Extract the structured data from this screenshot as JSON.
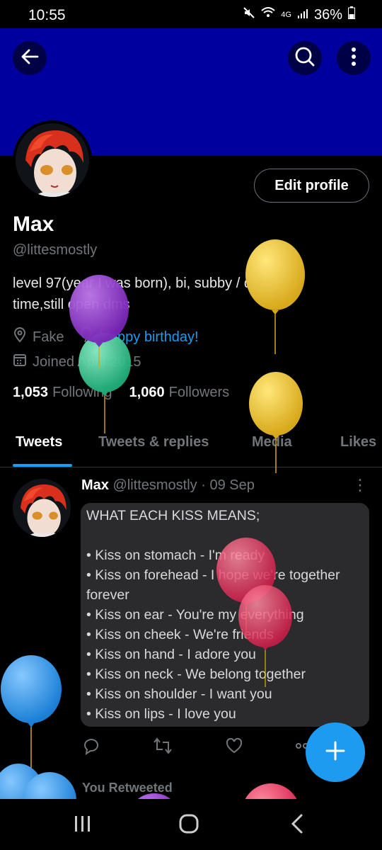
{
  "status": {
    "time": "10:55",
    "network": "4G",
    "battery": "36%"
  },
  "profile": {
    "edit_label": "Edit profile",
    "name": "Max",
    "handle": "@littesmostly",
    "bio": "level 97(year I was born), bi, subby / dom at\ntime,still open dms",
    "location": "Fake",
    "birthday": "Happy birthday!",
    "joined": "Joined April 2015",
    "following_count": "1,053",
    "following_label": "Following",
    "followers_count": "1,060",
    "followers_label": "Followers"
  },
  "tabs": [
    "Tweets",
    "Tweets & replies",
    "Media",
    "Likes"
  ],
  "tweet": {
    "name": "Max",
    "handle_date": "@littesmostly · 09 Sep",
    "image_lines": [
      "WHAT EACH KISS MEANS;",
      "",
      "• Kiss on stomach - I'm ready",
      "• Kiss on forehead - I hope we're together",
      "forever",
      "• Kiss on ear - You're my everything",
      "• Kiss on cheek - We're friends",
      "• Kiss on hand - I adore you",
      "• Kiss on neck - We belong together",
      "• Kiss on shoulder - I want you",
      "• Kiss on lips - I love you"
    ]
  },
  "retweeted_label": "You Retweeted",
  "colors": {
    "banner": "#00009e",
    "accent": "#1d9bf0",
    "background": "#000000"
  },
  "icons": [
    "back-arrow-icon",
    "search-icon",
    "more-vertical-icon",
    "location-icon",
    "balloon-icon",
    "calendar-icon",
    "reply-icon",
    "retweet-icon",
    "like-icon",
    "share-icon",
    "plus-icon"
  ]
}
